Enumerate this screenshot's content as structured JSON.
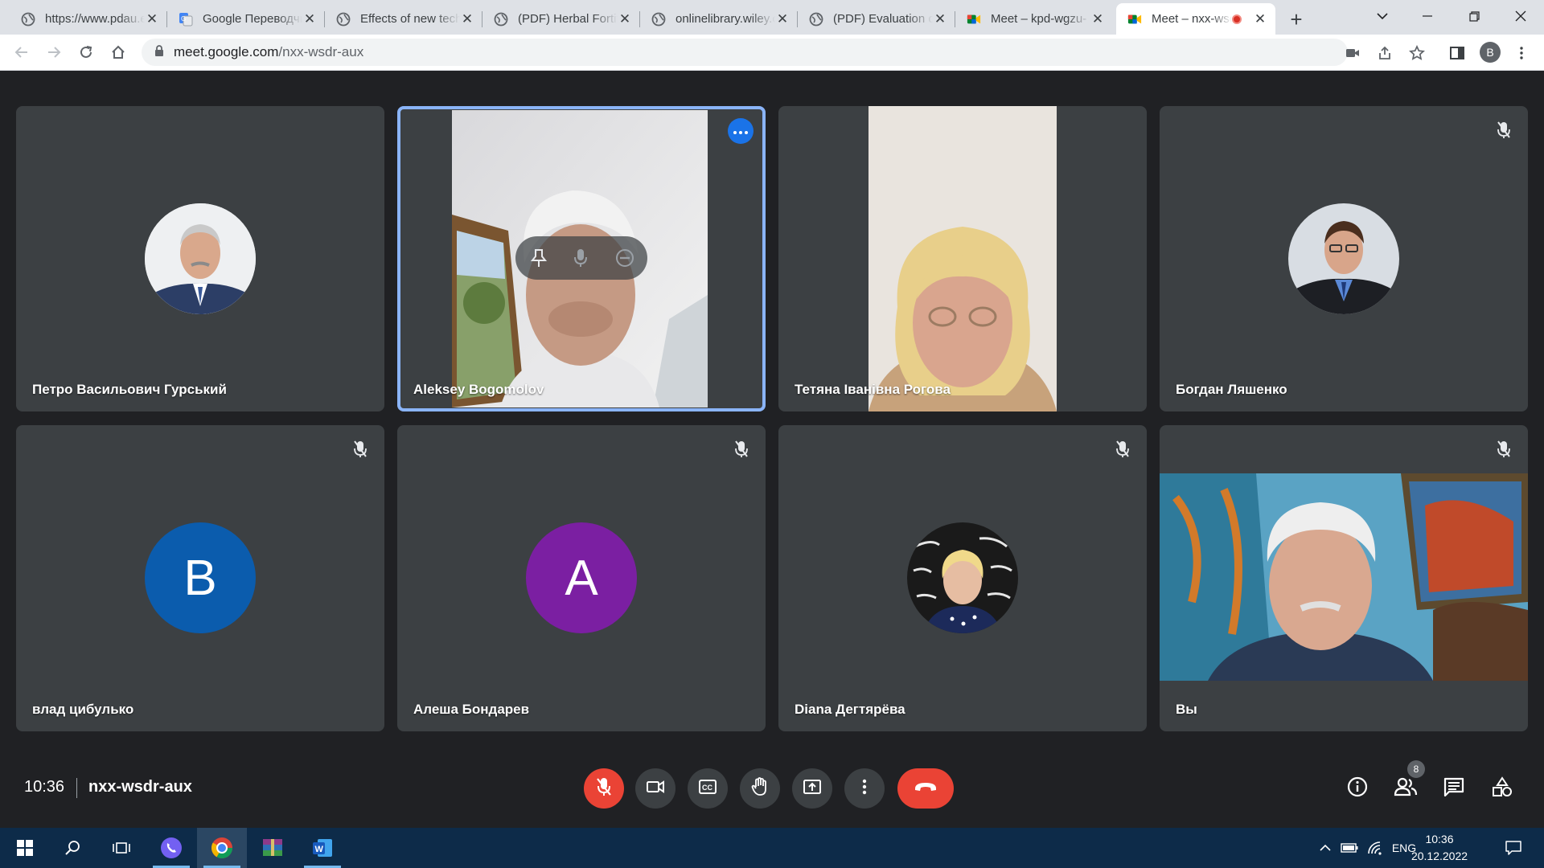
{
  "browser": {
    "tabs": [
      {
        "title": "https://www.pdau.edu.ua",
        "icon": "globe-icon"
      },
      {
        "title": "Google Переводчик",
        "icon": "google-translate-icon"
      },
      {
        "title": "Effects of new technologies",
        "icon": "globe-icon"
      },
      {
        "title": "(PDF) Herbal Fortification",
        "icon": "globe-icon"
      },
      {
        "title": "onlinelibrary.wiley.com",
        "icon": "globe-icon"
      },
      {
        "title": "(PDF) Evaluation of",
        "icon": "globe-icon"
      },
      {
        "title": "Meet – kpd-wgzu-",
        "icon": "meet-icon"
      },
      {
        "title": "Meet – nxx-wsdr-aux",
        "icon": "meet-icon",
        "active": true
      }
    ],
    "url_host": "meet.google.com",
    "url_path": "/nxx-wsdr-aux",
    "profile_initial": "B"
  },
  "meeting": {
    "participants": [
      {
        "name": "Петро Васильович Гурський"
      },
      {
        "name": "Aleksey Bogomolov"
      },
      {
        "name": "Тетяна Іванівна Рогова"
      },
      {
        "name": "Богдан Ляшенко"
      },
      {
        "name": "влад цибулько",
        "initial": "В"
      },
      {
        "name": "Алеша Бондарев",
        "initial": "А"
      },
      {
        "name": "Diana Дегтярёва"
      },
      {
        "name": "Вы"
      }
    ],
    "time": "10:36",
    "code": "nxx-wsdr-aux",
    "people_count": "8"
  },
  "taskbar": {
    "language": "ENG",
    "clock_time": "10:36",
    "clock_date": "20.12.2022"
  },
  "colors": {
    "background": "#202124",
    "tile": "#3c4043",
    "active_border": "#8ab4f8",
    "danger": "#ea4335",
    "avatar_blue": "#0b5cad",
    "avatar_purple": "#7b1fa2"
  }
}
